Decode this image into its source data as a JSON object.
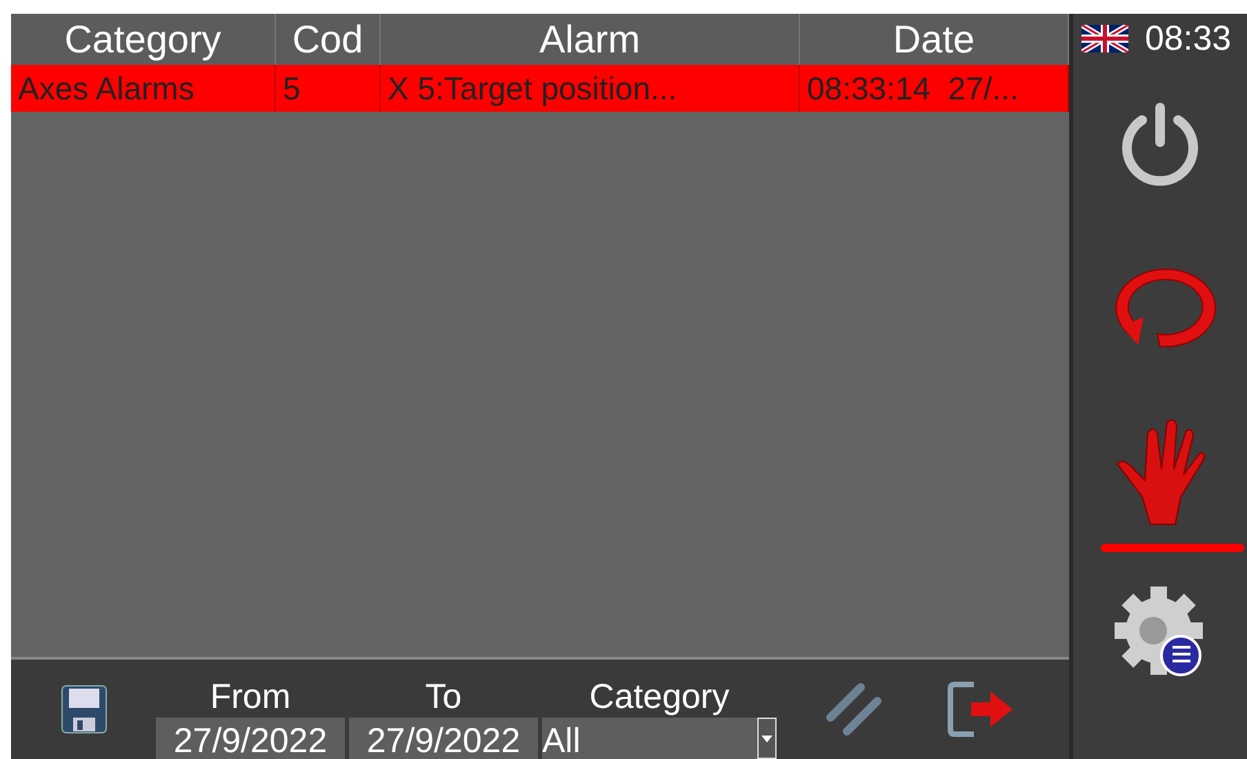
{
  "table": {
    "columns": [
      "Category",
      "Cod",
      "Alarm",
      "Date"
    ],
    "rows": [
      {
        "cells": [
          "Axes Alarms",
          "5",
          "X 5:Target position...",
          "08:33:14  27/..."
        ],
        "selected": true
      }
    ]
  },
  "filter": {
    "from_label": "From",
    "from_value": "27/9/2022",
    "to_label": "To",
    "to_value": "27/9/2022",
    "category_label": "Category",
    "category_value": "All"
  },
  "status": {
    "time": "08:33"
  },
  "sidebar": {
    "items": [
      {
        "kind": "power",
        "selected": false
      },
      {
        "kind": "cycle",
        "selected": false
      },
      {
        "kind": "hand",
        "selected": true
      },
      {
        "kind": "settings",
        "selected": false
      }
    ]
  }
}
